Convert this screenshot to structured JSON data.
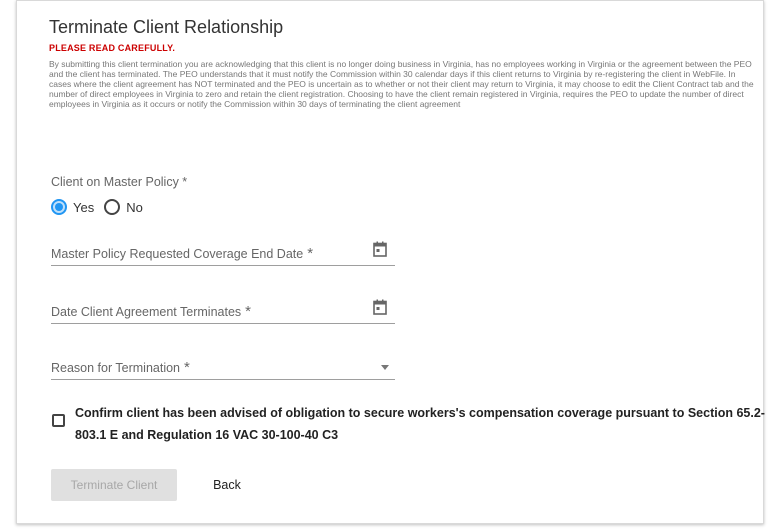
{
  "page": {
    "title": "Terminate Client Relationship",
    "warning": "PLEASE READ CAREFULLY.",
    "notice": "By submitting this client termination you are acknowledging that this client is no longer doing business in Virginia, has no employees working in Virginia or the agreement between the PEO and the client has terminated. The PEO understands that it must notify the Commission within 30 calendar days if this client returns to Virginia by re-registering the client in WebFile. In cases where the client agreement has NOT terminated and the PEO is uncertain as to whether or not their client may return to Virginia, it may choose to edit the Client Contract tab and the number of direct employees in Virginia to zero and retain the client registration. Choosing to have the client remain registered in Virginia, requires the PEO to update the number of direct employees in Virginia as it occurs or notify the Commission within 30 days of terminating the client agreement"
  },
  "master_policy": {
    "label": "Client on Master Policy *",
    "options": [
      {
        "label": "Yes",
        "selected": true
      },
      {
        "label": "No",
        "selected": false
      }
    ]
  },
  "fields": {
    "coverage_end_date": {
      "label": "Master Policy Requested Coverage End Date",
      "required_mark": "*",
      "icon": "calendar-icon"
    },
    "agreement_terminates": {
      "label": "Date Client Agreement Terminates",
      "required_mark": "*",
      "icon": "calendar-icon"
    },
    "reason": {
      "label": "Reason for Termination",
      "required_mark": "*",
      "icon": "dropdown-arrow-icon"
    }
  },
  "confirm": {
    "text": "Confirm client has been advised of obligation to secure workers's compensation coverage pursuant to Section 65.2-803.1 E and Regulation 16 VAC 30-100-40 C3",
    "checked": false
  },
  "actions": {
    "terminate_label": "Terminate Client",
    "back_label": "Back"
  },
  "colors": {
    "warning": "#cc0000",
    "accent": "#2196f3",
    "disabled_bg": "#e0e0e0"
  }
}
